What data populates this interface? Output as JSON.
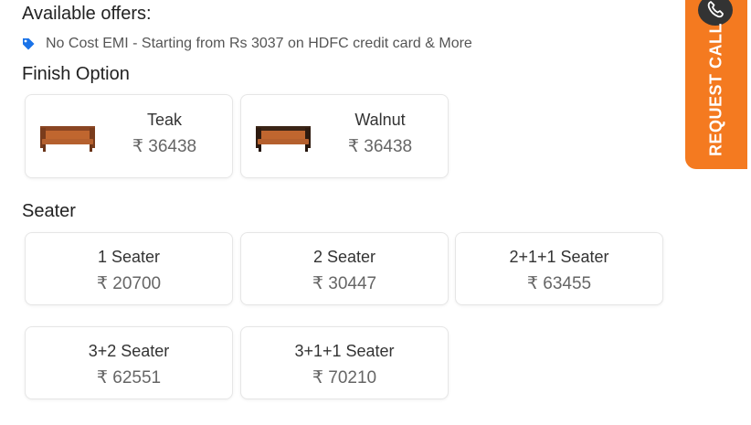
{
  "offers": {
    "title": "Available offers:",
    "items": [
      {
        "icon": "tag-icon",
        "text": "No Cost EMI - Starting from Rs 3037 on HDFC credit card & More"
      }
    ]
  },
  "finish_option": {
    "title": "Finish Option",
    "options": [
      {
        "name": "Teak",
        "price": "₹ 36438"
      },
      {
        "name": "Walnut",
        "price": "₹ 36438"
      }
    ]
  },
  "seater": {
    "title": "Seater",
    "options": [
      {
        "name": "1 Seater",
        "price": "₹ 20700"
      },
      {
        "name": "2 Seater",
        "price": "₹ 30447"
      },
      {
        "name": "2+1+1 Seater",
        "price": "₹ 63455"
      },
      {
        "name": "3+2 Seater",
        "price": "₹ 62551"
      },
      {
        "name": "3+1+1 Seater",
        "price": "₹ 70210"
      }
    ]
  },
  "request_call": {
    "label": "REQUEST CALL",
    "icon": "phone-icon"
  },
  "colors": {
    "accent": "#f47a20",
    "tag": "#1a73e8",
    "teak": "#b5602e",
    "walnut": "#3b2416"
  }
}
